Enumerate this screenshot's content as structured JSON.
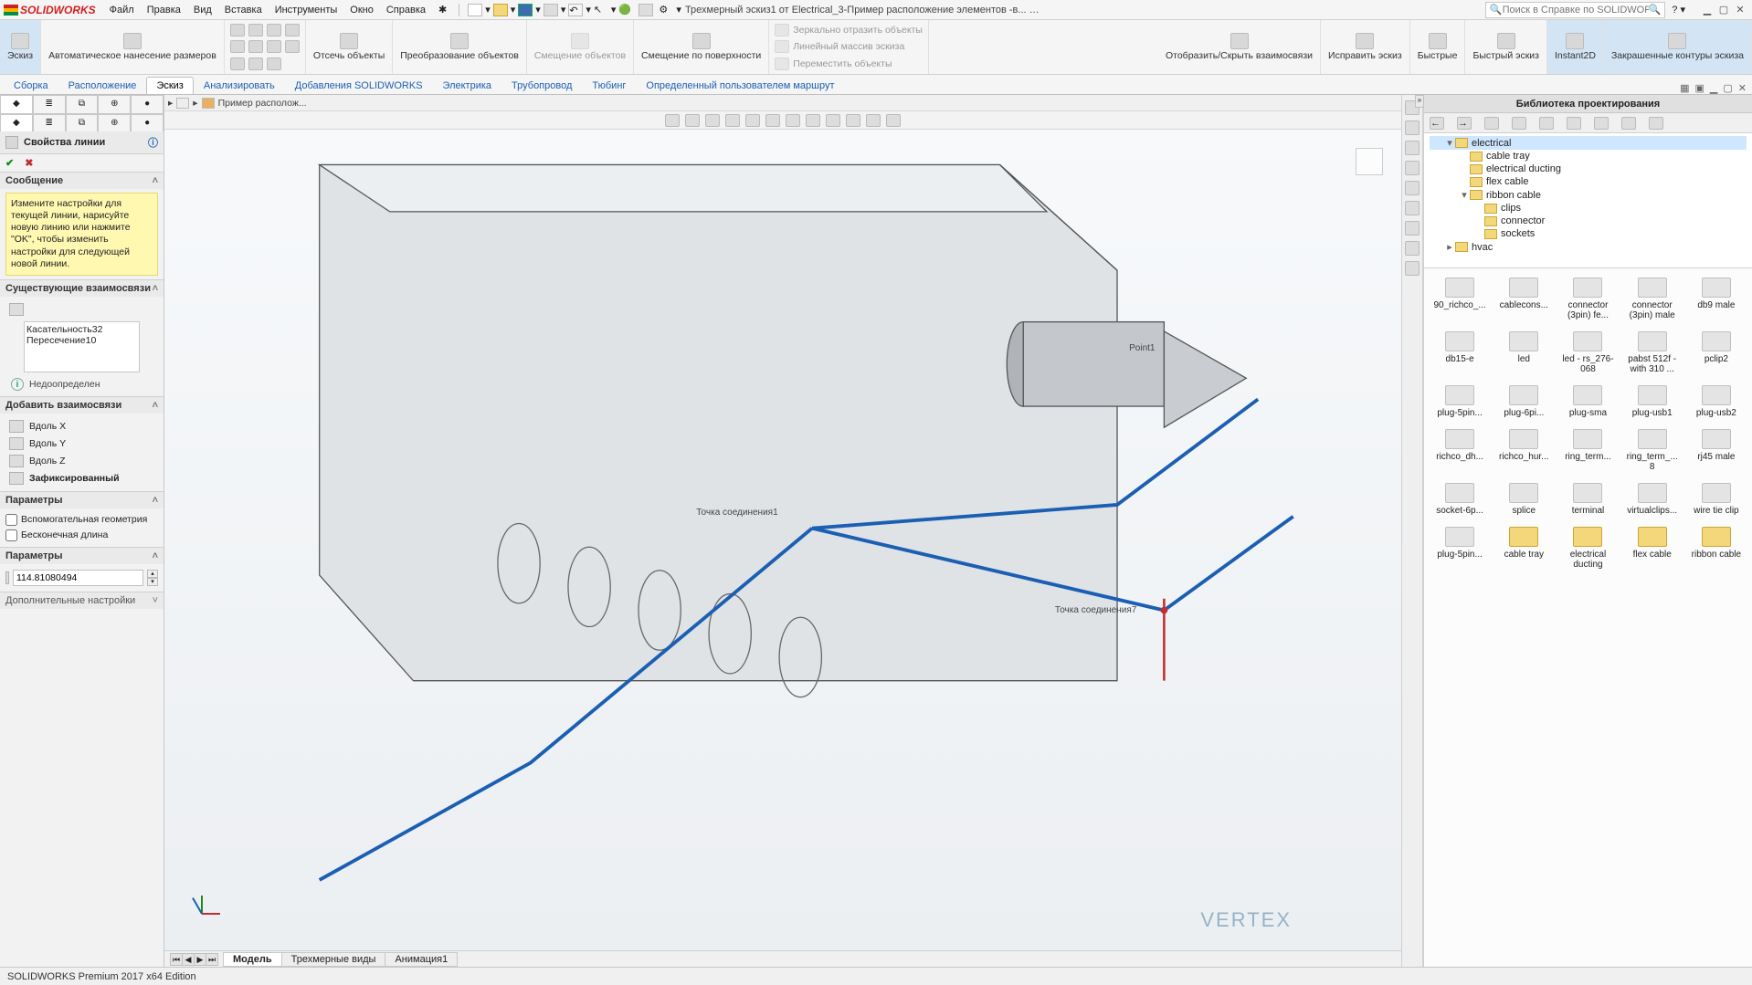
{
  "app": {
    "logo_text": "SOLIDWORKS",
    "doc_title": "Трехмерный эскиз1 от Electrical_3-Пример расположение элементов -в... Прим...",
    "search_placeholder": "Поиск в Справке по SOLIDWORKS",
    "status": "SOLIDWORKS Premium 2017 x64 Edition"
  },
  "menu": [
    "Файл",
    "Правка",
    "Вид",
    "Вставка",
    "Инструменты",
    "Окно",
    "Справка"
  ],
  "ribbon_big": [
    {
      "label": "Эскиз",
      "sel": true
    },
    {
      "label": "Автоматическое нанесение размеров"
    }
  ],
  "ribbon_mid": [
    {
      "label": "Отсечь объекты"
    },
    {
      "label": "Преобразование объектов"
    },
    {
      "label": "Смещение объектов",
      "dis": true
    },
    {
      "label": "Смещение по поверхности"
    }
  ],
  "ribbon_text_cmds": [
    "Зеркально отразить объекты",
    "Линейный массив эскиза",
    "Переместить объекты"
  ],
  "ribbon_right": [
    {
      "label": "Отобразить/Скрыть взаимосвязи"
    },
    {
      "label": "Исправить эскиз"
    },
    {
      "label": "Быстрые"
    },
    {
      "label": "Быстрый эскиз"
    },
    {
      "label": "Instant2D",
      "sel": true
    },
    {
      "label": "Закрашенные контуры эскиза",
      "sel": true
    }
  ],
  "tabs": [
    "Сборка",
    "Расположение",
    "Эскиз",
    "Анализировать",
    "Добавления SOLIDWORKS",
    "Электрика",
    "Трубопровод",
    "Тюбинг",
    "Определенный пользователем маршрут"
  ],
  "tabs_active": 2,
  "crumb": "Пример располож...",
  "pm": {
    "title": "Свойства линии",
    "msg_head": "Сообщение",
    "msg": "Измените настройки для текущей линии, нарисуйте новую линию или нажмите \"OK\", чтобы изменить настройки для следующей новой линии.",
    "rel_head": "Существующие взаимосвязи",
    "relations": [
      "Касательность32",
      "Пересечение10"
    ],
    "info": "Недоопределен",
    "add_head": "Добавить взаимосвязи",
    "add_items": [
      "Вдоль X",
      "Вдоль Y",
      "Вдоль Z",
      "Зафиксированный"
    ],
    "par1_head": "Параметры",
    "chk1": "Вспомогательная геометрия",
    "chk2": "Бесконечная длина",
    "par2_head": "Параметры",
    "param_val": "114.81080494",
    "extra_head": "Дополнительные настройки"
  },
  "viewport": {
    "annot1": "Point1",
    "annot2": "Точка соединения7",
    "annot3": "Точка соединения1",
    "brand": "VERTEX"
  },
  "view_tabs": [
    "Модель",
    "Трехмерные виды",
    "Анимация1"
  ],
  "right": {
    "title": "Библиотека проектирования",
    "tree": [
      {
        "indent": 1,
        "exp": "▾",
        "label": "electrical",
        "sel": true
      },
      {
        "indent": 2,
        "exp": "",
        "label": "cable tray"
      },
      {
        "indent": 2,
        "exp": "",
        "label": "electrical ducting"
      },
      {
        "indent": 2,
        "exp": "",
        "label": "flex cable"
      },
      {
        "indent": 2,
        "exp": "▾",
        "label": "ribbon cable"
      },
      {
        "indent": 3,
        "exp": "",
        "label": "clips"
      },
      {
        "indent": 3,
        "exp": "",
        "label": "connector"
      },
      {
        "indent": 3,
        "exp": "",
        "label": "sockets"
      },
      {
        "indent": 1,
        "exp": "▸",
        "label": "hvac"
      }
    ],
    "items": [
      {
        "label": "90_richco_..."
      },
      {
        "label": "cablecons..."
      },
      {
        "label": "connector (3pin) fe..."
      },
      {
        "label": "connector (3pin) male"
      },
      {
        "label": "db9 male"
      },
      {
        "label": "db15-e"
      },
      {
        "label": "led"
      },
      {
        "label": "led - rs_276-068"
      },
      {
        "label": "pabst 512f - with 310 ..."
      },
      {
        "label": "pclip2"
      },
      {
        "label": "plug-5pin..."
      },
      {
        "label": "plug-6pi..."
      },
      {
        "label": "plug-sma"
      },
      {
        "label": "plug-usb1"
      },
      {
        "label": "plug-usb2"
      },
      {
        "label": "richco_dh..."
      },
      {
        "label": "richco_hur..."
      },
      {
        "label": "ring_term..."
      },
      {
        "label": "ring_term_... 8"
      },
      {
        "label": "rj45 male"
      },
      {
        "label": "socket-6p..."
      },
      {
        "label": "splice"
      },
      {
        "label": "terminal"
      },
      {
        "label": "virtualclips..."
      },
      {
        "label": "wire tie clip"
      },
      {
        "label": "plug-5pin..."
      },
      {
        "label": "cable tray",
        "folder": true
      },
      {
        "label": "electrical ducting",
        "folder": true
      },
      {
        "label": "flex cable",
        "folder": true
      },
      {
        "label": "ribbon cable",
        "folder": true
      }
    ]
  }
}
